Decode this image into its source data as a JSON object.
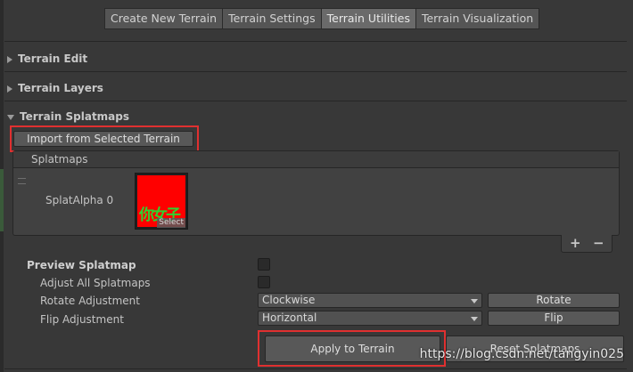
{
  "tabs": [
    {
      "label": "Create New Terrain",
      "active": false
    },
    {
      "label": "Terrain Settings",
      "active": false
    },
    {
      "label": "Terrain Utilities",
      "active": true
    },
    {
      "label": "Terrain Visualization",
      "active": false
    }
  ],
  "sections": {
    "terrain_edit": "Terrain Edit",
    "terrain_layers": "Terrain Layers",
    "terrain_splatmaps": "Terrain Splatmaps"
  },
  "import_button": "Import from Selected Terrain",
  "splatmaps": {
    "header": "Splatmaps",
    "item_label": "SplatAlpha 0",
    "thumbnail_text": "你女子",
    "select_label": "Select",
    "add_label": "+",
    "remove_label": "−"
  },
  "preview": {
    "title": "Preview Splatmap",
    "adjust_all": "Adjust All Splatmaps",
    "rotate_label": "Rotate Adjustment",
    "rotate_value": "Clockwise",
    "rotate_button": "Rotate",
    "flip_label": "Flip Adjustment",
    "flip_value": "Horizontal",
    "flip_button": "Flip"
  },
  "apply_button": "Apply to Terrain",
  "reset_button": "Reset Splatmaps",
  "watermark": "https://blog.csdn.net/tangyin025",
  "colors": {
    "highlight": "#e03030",
    "splat_red": "#ff0000",
    "splat_green": "#2fd32f"
  }
}
